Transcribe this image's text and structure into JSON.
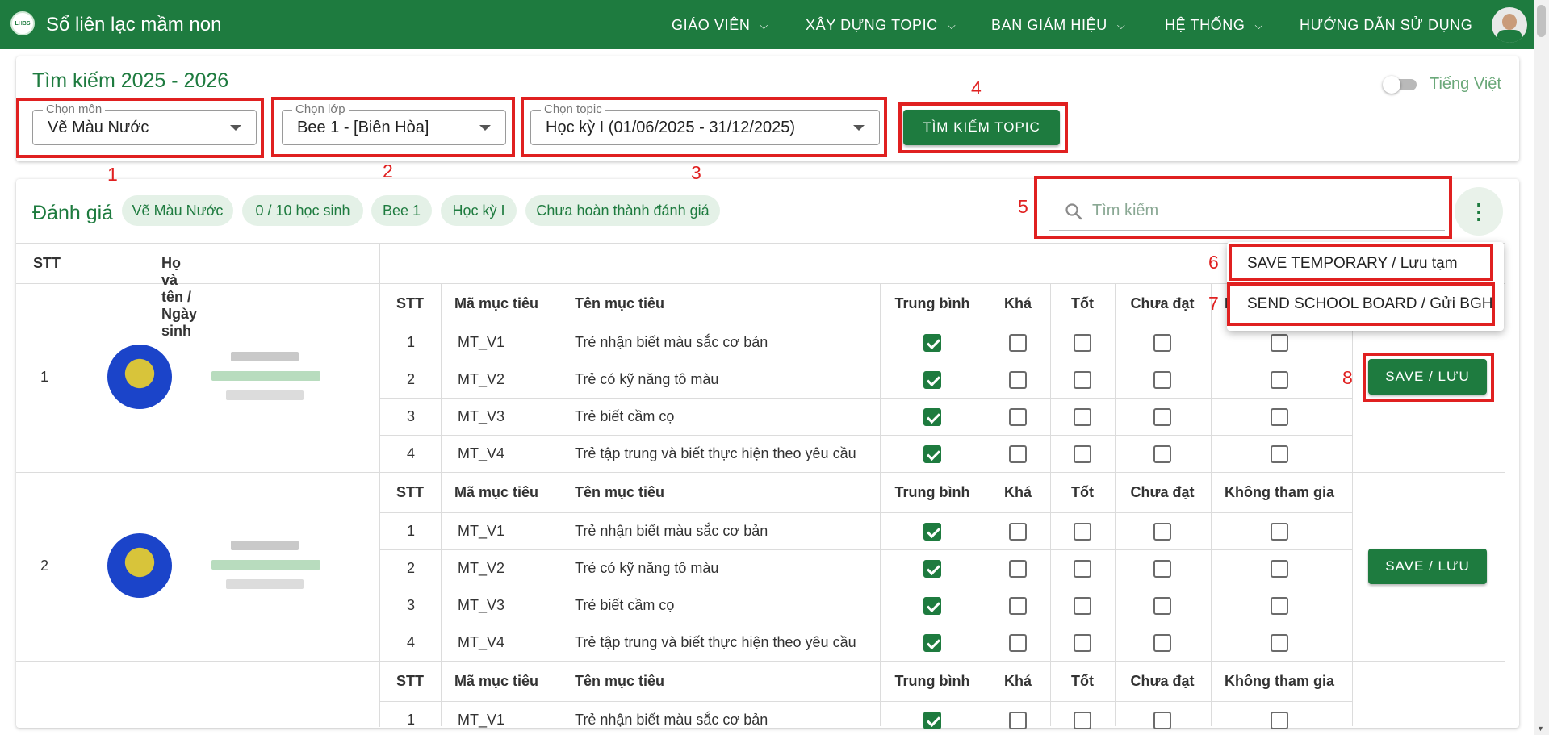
{
  "app": {
    "title": "Sổ liên lạc mầm non",
    "logo_text": "LHBS"
  },
  "nav": [
    "GIÁO VIÊN",
    "XÂY DỰNG TOPIC",
    "BAN GIÁM HIỆU",
    "HỆ THỐNG",
    "HƯỚNG DẪN SỬ DỤNG"
  ],
  "search": {
    "title": "Tìm kiếm 2025 - 2026",
    "language_label": "Tiếng Việt",
    "subject": {
      "label": "Chọn môn",
      "value": "Vẽ Màu Nước"
    },
    "class": {
      "label": "Chọn lớp",
      "value": "Bee 1 - [Biên Hòa]"
    },
    "topic": {
      "label": "Chọn topic",
      "value": "Học kỳ I (01/06/2025 - 31/12/2025)"
    },
    "button": "TÌM KIẾM TOPIC"
  },
  "eval": {
    "title": "Đánh giá",
    "chips": [
      "Vẽ Màu Nước",
      "0 / 10 học sinh",
      "Bee 1",
      "Học kỳ I",
      "Chưa hoàn thành đánh giá"
    ],
    "search_placeholder": "Tìm kiếm"
  },
  "menu": {
    "save_temp": "SAVE TEMPORARY / Lưu tạm",
    "send_board": "SEND SCHOOL BOARD / Gửi BGH"
  },
  "table": {
    "col_stt": "STT",
    "col_name": "Họ và tên / Ngày sinh",
    "sub_headers": [
      "STT",
      "Mã mục tiêu",
      "Tên mục tiêu",
      "Trung bình",
      "Khá",
      "Tốt",
      "Chưa đạt",
      "Không tham gia"
    ],
    "save_label": "SAVE / LƯU",
    "students": [
      {
        "stt": "1",
        "goals": [
          {
            "stt": "1",
            "code": "MT_V1",
            "name": "Trẻ nhận biết màu sắc cơ bản"
          },
          {
            "stt": "2",
            "code": "MT_V2",
            "name": "Trẻ có kỹ năng tô màu"
          },
          {
            "stt": "3",
            "code": "MT_V3",
            "name": "Trẻ biết cầm cọ"
          },
          {
            "stt": "4",
            "code": "MT_V4",
            "name": "Trẻ tập trung và biết thực hiện theo yêu cầu"
          }
        ]
      },
      {
        "stt": "2",
        "goals": [
          {
            "stt": "1",
            "code": "MT_V1",
            "name": "Trẻ nhận biết màu sắc cơ bản"
          },
          {
            "stt": "2",
            "code": "MT_V2",
            "name": "Trẻ có kỹ năng tô màu"
          },
          {
            "stt": "3",
            "code": "MT_V3",
            "name": "Trẻ biết cầm cọ"
          },
          {
            "stt": "4",
            "code": "MT_V4",
            "name": "Trẻ tập trung và biết thực hiện theo yêu cầu"
          }
        ]
      },
      {
        "stt": "",
        "goals": [
          {
            "stt": "1",
            "code": "MT_V1",
            "name": "Trẻ nhận biết màu sắc cơ bản"
          }
        ]
      }
    ]
  },
  "annotations": [
    "1",
    "2",
    "3",
    "4",
    "5",
    "6",
    "7",
    "8"
  ],
  "colors": {
    "brand": "#1e7b3f",
    "annotation": "#e02020",
    "chip_bg": "#e4f1e7"
  }
}
